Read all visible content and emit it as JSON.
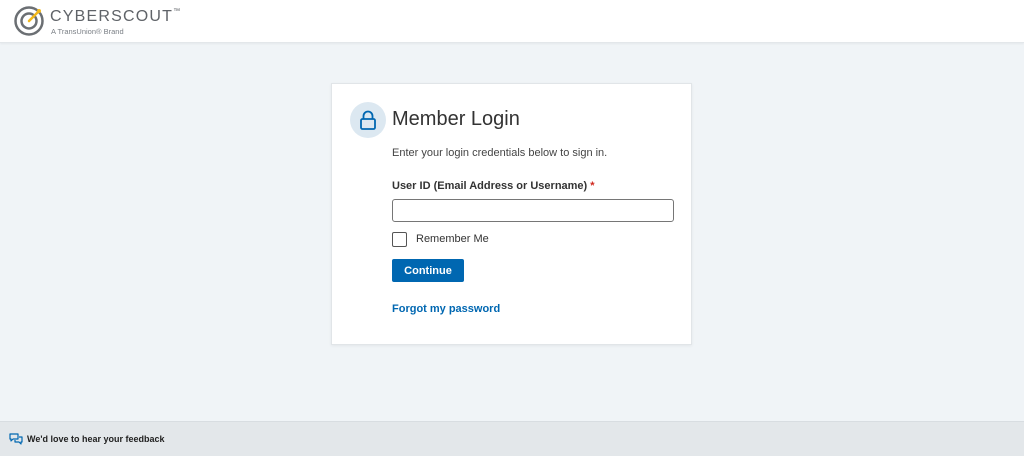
{
  "header": {
    "logo": {
      "name": "CYBERSCOUT",
      "trademark": "™",
      "tagline": "A TransUnion® Brand"
    }
  },
  "login": {
    "icon": "lock-icon",
    "title": "Member Login",
    "subtitle": "Enter your login credentials below to sign in.",
    "user_id_label": "User ID (Email Address or Username)",
    "required_marker": "*",
    "user_id_value": "",
    "remember_me_label": "Remember Me",
    "remember_me_checked": false,
    "continue_label": "Continue",
    "forgot_link": "Forgot my password"
  },
  "footer": {
    "feedback_icon": "chat-bubbles-icon",
    "feedback_label": "We'd love to hear your feedback"
  },
  "colors": {
    "accent": "#0067b1",
    "page_background": "#f0f4f7",
    "required": "#d0271d",
    "logo_accent": "#f2b81c"
  }
}
